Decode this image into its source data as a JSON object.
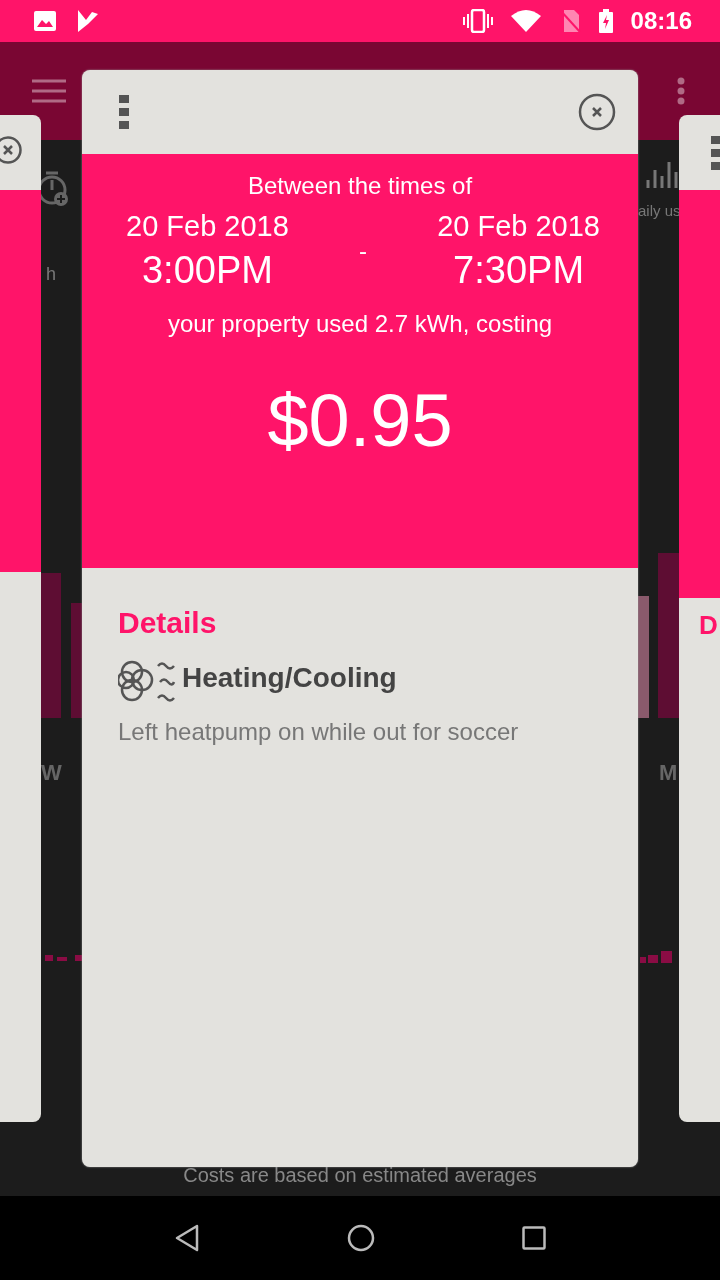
{
  "status_bar": {
    "time": "08:16"
  },
  "background": {
    "left_label": "h",
    "right_label": "aily us",
    "left_axis": "W",
    "right_axis": "M",
    "footer": "Costs are based on estimated averages"
  },
  "card": {
    "heading": "Between the times of",
    "start": {
      "date": "20 Feb 2018",
      "time": "3:00PM"
    },
    "separator": "-",
    "end": {
      "date": "20 Feb 2018",
      "time": "7:30PM"
    },
    "summary": "your property used 2.7 kWh, costing",
    "cost": "$0.95",
    "details_title": "Details",
    "category": "Heating/Cooling",
    "note": "Left heatpump on while out for soccer"
  },
  "right_card": {
    "details_title": "D"
  }
}
